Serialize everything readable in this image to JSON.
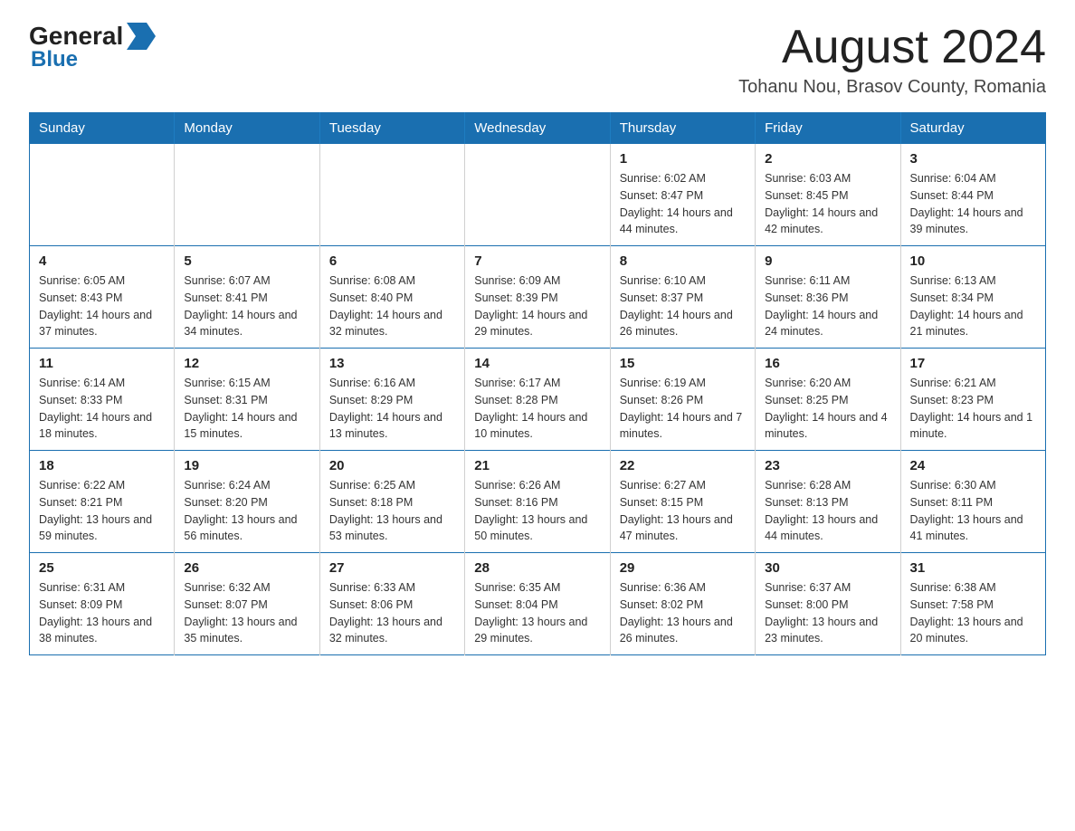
{
  "header": {
    "logo_text_general": "General",
    "logo_text_blue": "Blue",
    "month_title": "August 2024",
    "location": "Tohanu Nou, Brasov County, Romania"
  },
  "days_of_week": [
    "Sunday",
    "Monday",
    "Tuesday",
    "Wednesday",
    "Thursday",
    "Friday",
    "Saturday"
  ],
  "weeks": [
    [
      {
        "day": "",
        "info": ""
      },
      {
        "day": "",
        "info": ""
      },
      {
        "day": "",
        "info": ""
      },
      {
        "day": "",
        "info": ""
      },
      {
        "day": "1",
        "info": "Sunrise: 6:02 AM\nSunset: 8:47 PM\nDaylight: 14 hours and 44 minutes."
      },
      {
        "day": "2",
        "info": "Sunrise: 6:03 AM\nSunset: 8:45 PM\nDaylight: 14 hours and 42 minutes."
      },
      {
        "day": "3",
        "info": "Sunrise: 6:04 AM\nSunset: 8:44 PM\nDaylight: 14 hours and 39 minutes."
      }
    ],
    [
      {
        "day": "4",
        "info": "Sunrise: 6:05 AM\nSunset: 8:43 PM\nDaylight: 14 hours and 37 minutes."
      },
      {
        "day": "5",
        "info": "Sunrise: 6:07 AM\nSunset: 8:41 PM\nDaylight: 14 hours and 34 minutes."
      },
      {
        "day": "6",
        "info": "Sunrise: 6:08 AM\nSunset: 8:40 PM\nDaylight: 14 hours and 32 minutes."
      },
      {
        "day": "7",
        "info": "Sunrise: 6:09 AM\nSunset: 8:39 PM\nDaylight: 14 hours and 29 minutes."
      },
      {
        "day": "8",
        "info": "Sunrise: 6:10 AM\nSunset: 8:37 PM\nDaylight: 14 hours and 26 minutes."
      },
      {
        "day": "9",
        "info": "Sunrise: 6:11 AM\nSunset: 8:36 PM\nDaylight: 14 hours and 24 minutes."
      },
      {
        "day": "10",
        "info": "Sunrise: 6:13 AM\nSunset: 8:34 PM\nDaylight: 14 hours and 21 minutes."
      }
    ],
    [
      {
        "day": "11",
        "info": "Sunrise: 6:14 AM\nSunset: 8:33 PM\nDaylight: 14 hours and 18 minutes."
      },
      {
        "day": "12",
        "info": "Sunrise: 6:15 AM\nSunset: 8:31 PM\nDaylight: 14 hours and 15 minutes."
      },
      {
        "day": "13",
        "info": "Sunrise: 6:16 AM\nSunset: 8:29 PM\nDaylight: 14 hours and 13 minutes."
      },
      {
        "day": "14",
        "info": "Sunrise: 6:17 AM\nSunset: 8:28 PM\nDaylight: 14 hours and 10 minutes."
      },
      {
        "day": "15",
        "info": "Sunrise: 6:19 AM\nSunset: 8:26 PM\nDaylight: 14 hours and 7 minutes."
      },
      {
        "day": "16",
        "info": "Sunrise: 6:20 AM\nSunset: 8:25 PM\nDaylight: 14 hours and 4 minutes."
      },
      {
        "day": "17",
        "info": "Sunrise: 6:21 AM\nSunset: 8:23 PM\nDaylight: 14 hours and 1 minute."
      }
    ],
    [
      {
        "day": "18",
        "info": "Sunrise: 6:22 AM\nSunset: 8:21 PM\nDaylight: 13 hours and 59 minutes."
      },
      {
        "day": "19",
        "info": "Sunrise: 6:24 AM\nSunset: 8:20 PM\nDaylight: 13 hours and 56 minutes."
      },
      {
        "day": "20",
        "info": "Sunrise: 6:25 AM\nSunset: 8:18 PM\nDaylight: 13 hours and 53 minutes."
      },
      {
        "day": "21",
        "info": "Sunrise: 6:26 AM\nSunset: 8:16 PM\nDaylight: 13 hours and 50 minutes."
      },
      {
        "day": "22",
        "info": "Sunrise: 6:27 AM\nSunset: 8:15 PM\nDaylight: 13 hours and 47 minutes."
      },
      {
        "day": "23",
        "info": "Sunrise: 6:28 AM\nSunset: 8:13 PM\nDaylight: 13 hours and 44 minutes."
      },
      {
        "day": "24",
        "info": "Sunrise: 6:30 AM\nSunset: 8:11 PM\nDaylight: 13 hours and 41 minutes."
      }
    ],
    [
      {
        "day": "25",
        "info": "Sunrise: 6:31 AM\nSunset: 8:09 PM\nDaylight: 13 hours and 38 minutes."
      },
      {
        "day": "26",
        "info": "Sunrise: 6:32 AM\nSunset: 8:07 PM\nDaylight: 13 hours and 35 minutes."
      },
      {
        "day": "27",
        "info": "Sunrise: 6:33 AM\nSunset: 8:06 PM\nDaylight: 13 hours and 32 minutes."
      },
      {
        "day": "28",
        "info": "Sunrise: 6:35 AM\nSunset: 8:04 PM\nDaylight: 13 hours and 29 minutes."
      },
      {
        "day": "29",
        "info": "Sunrise: 6:36 AM\nSunset: 8:02 PM\nDaylight: 13 hours and 26 minutes."
      },
      {
        "day": "30",
        "info": "Sunrise: 6:37 AM\nSunset: 8:00 PM\nDaylight: 13 hours and 23 minutes."
      },
      {
        "day": "31",
        "info": "Sunrise: 6:38 AM\nSunset: 7:58 PM\nDaylight: 13 hours and 20 minutes."
      }
    ]
  ]
}
